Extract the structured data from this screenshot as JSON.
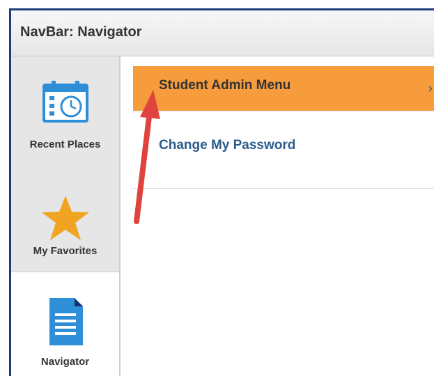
{
  "window": {
    "title": "NavBar: Navigator"
  },
  "sidebar": {
    "items": [
      {
        "label": "Recent Places",
        "icon": "calendar-clock-icon"
      },
      {
        "label": "My Favorites",
        "icon": "star-icon"
      },
      {
        "label": "Navigator",
        "icon": "document-icon"
      }
    ]
  },
  "menu": {
    "items": [
      {
        "label": "Student Admin Menu",
        "chevron": "›",
        "selected": true
      },
      {
        "label": "Change My Password",
        "selected": false
      }
    ]
  },
  "colors": {
    "frame_border": "#1f3c7a",
    "selected_row": "#f79c3c",
    "link_text": "#2b5c8a",
    "icon_blue": "#2e8fd8",
    "star_orange": "#f0a422",
    "annotation_arrow": "#e0433e"
  }
}
